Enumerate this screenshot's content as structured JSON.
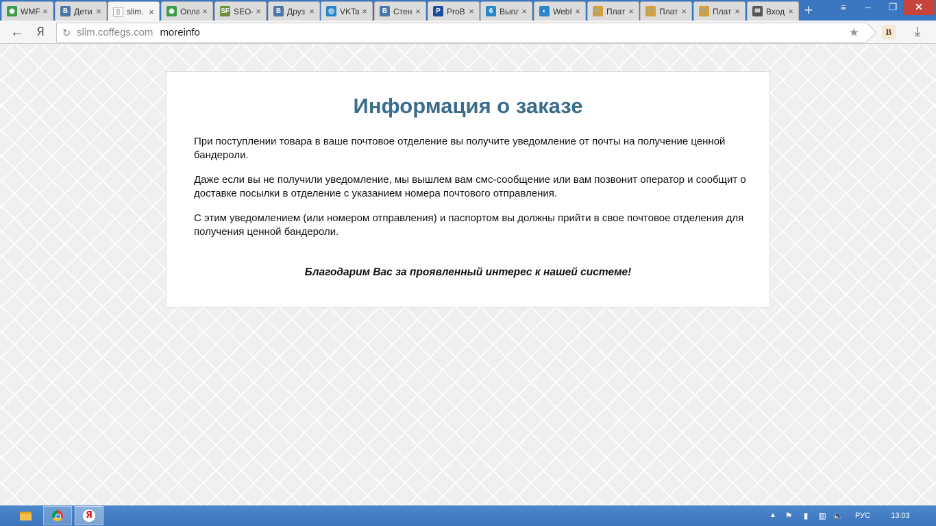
{
  "browser": {
    "tabs": [
      {
        "title": "WMF",
        "favicon": "green-globe-icon",
        "color": "#3c9a4a",
        "glyph": "◉",
        "active": false
      },
      {
        "title": "Дети",
        "favicon": "vk-icon",
        "color": "#4a76a8",
        "glyph": "B",
        "active": false
      },
      {
        "title": "slim.",
        "favicon": "page-icon",
        "color": "#ffffff",
        "glyph": "▯",
        "active": true
      },
      {
        "title": "Опла",
        "favicon": "green-globe-icon",
        "color": "#3c9a4a",
        "glyph": "◉",
        "active": false
      },
      {
        "title": "SEO-",
        "favicon": "sf-icon",
        "color": "#6b8f3a",
        "glyph": "SF",
        "active": false
      },
      {
        "title": "Друз",
        "favicon": "vk-icon",
        "color": "#4a76a8",
        "glyph": "B",
        "active": false
      },
      {
        "title": "VKTa",
        "favicon": "target-icon",
        "color": "#2a86c8",
        "glyph": "◎",
        "active": false
      },
      {
        "title": "Стен",
        "favicon": "vk-icon",
        "color": "#4a76a8",
        "glyph": "B",
        "active": false
      },
      {
        "title": "ProB",
        "favicon": "p-icon",
        "color": "#1b4f9c",
        "glyph": "P",
        "active": false
      },
      {
        "title": "Выпл",
        "favicon": "lock-icon",
        "color": "#2a86c8",
        "glyph": "6",
        "active": false
      },
      {
        "title": "WebI",
        "favicon": "globe-icon",
        "color": "#2a86c8",
        "glyph": "◐",
        "active": false
      },
      {
        "title": "Плат",
        "favicon": "cart-icon",
        "color": "#d8a03a",
        "glyph": "🛒",
        "active": false
      },
      {
        "title": "Плат",
        "favicon": "cart-icon",
        "color": "#d8a03a",
        "glyph": "🛒",
        "active": false
      },
      {
        "title": "Плат",
        "favicon": "cart-icon",
        "color": "#d8a03a",
        "glyph": "🛒",
        "active": false
      },
      {
        "title": "Вход",
        "favicon": "mail-icon",
        "color": "#555555",
        "glyph": "✉",
        "active": false
      }
    ],
    "tab_close": "×",
    "new_tab": "+",
    "window_controls": {
      "menu": "≡",
      "minimize": "‒",
      "restore": "❐",
      "close": "✕"
    },
    "back": "←",
    "yandex": "Я",
    "reload": "↻",
    "url_domain": "slim.coffegs.com",
    "url_path": "moreinfo",
    "bookmark": "★",
    "extension": "B",
    "download": "⤓"
  },
  "page": {
    "title": "Информация о заказе",
    "paragraphs": [
      "При поступлении товара в ваше почтовое отделение вы получите уведомление от почты на получение ценной бандероли.",
      "Даже если вы не получили уведомление, мы вышлем вам смс-сообщение или вам позвонит оператор и сообщит о доставке посылки в отделение с указанием номера почтового отправления.",
      "С этим уведомлением (или номером отправления) и паспортом вы должны прийти в свое почтовое отделения для получения ценной бандероли."
    ],
    "thanks": "Благодарим Вас за проявленный интерес к нашей системе!"
  },
  "taskbar": {
    "tray_arrow": "▲",
    "flag": "⚑",
    "power": "▮",
    "network": "▥",
    "volume": "🔈",
    "language": "РУС",
    "clock": "13:03"
  }
}
